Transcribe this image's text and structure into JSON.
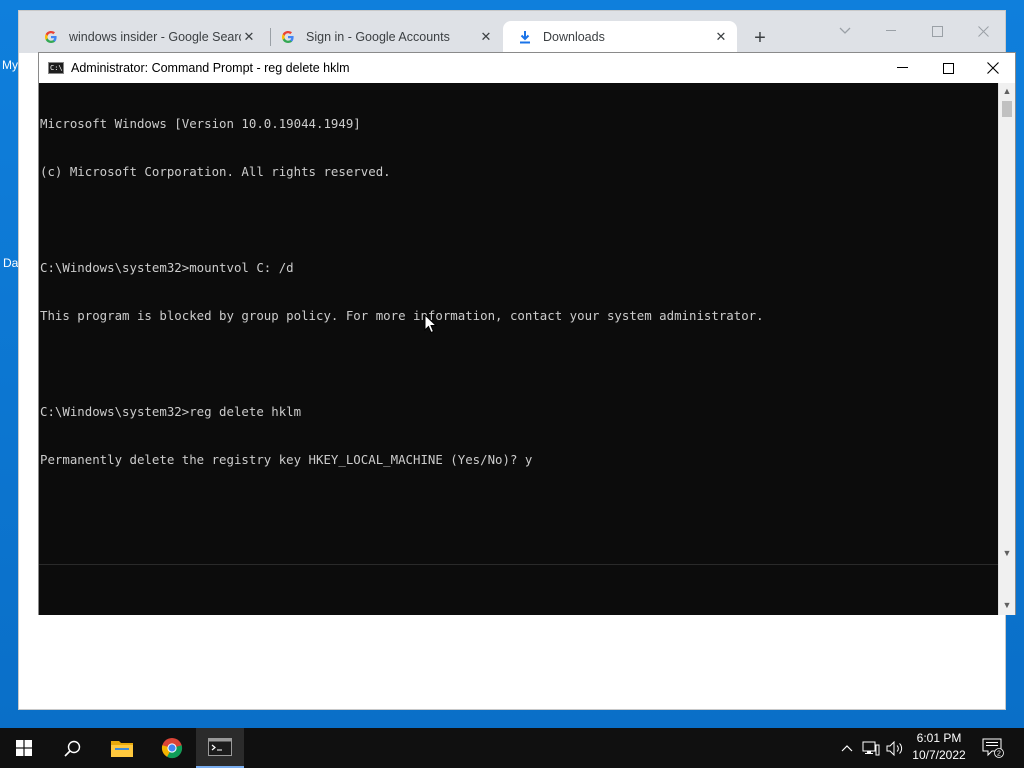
{
  "desktop": {
    "fragments": [
      "My",
      "Da"
    ]
  },
  "chrome": {
    "tabs": [
      {
        "title": "windows insider - Google Search",
        "favicon": "google-g-icon"
      },
      {
        "title": "Sign in - Google Accounts",
        "favicon": "google-g-icon"
      },
      {
        "title": "Downloads",
        "favicon": "download-icon"
      }
    ],
    "new_tab": "+"
  },
  "cmd": {
    "title": "Administrator: Command Prompt - reg  delete hklm",
    "lines": [
      "Microsoft Windows [Version 10.0.19044.1949]",
      "(c) Microsoft Corporation. All rights reserved.",
      "",
      "C:\\Windows\\system32>mountvol C: /d",
      "This program is blocked by group policy. For more information, contact your system administrator.",
      "",
      "C:\\Windows\\system32>reg delete hklm",
      "Permanently delete the registry key HKEY_LOCAL_MACHINE (Yes/No)? y"
    ],
    "colors": {
      "background": "#0c0c0c",
      "text": "#cccccc"
    }
  },
  "taskbar": {
    "apps": [
      "start-icon",
      "search-icon",
      "file-explorer-icon",
      "chrome-icon",
      "command-prompt-icon"
    ],
    "clock": {
      "time": "6:01 PM",
      "date": "10/7/2022"
    },
    "notifications_count": "2"
  }
}
